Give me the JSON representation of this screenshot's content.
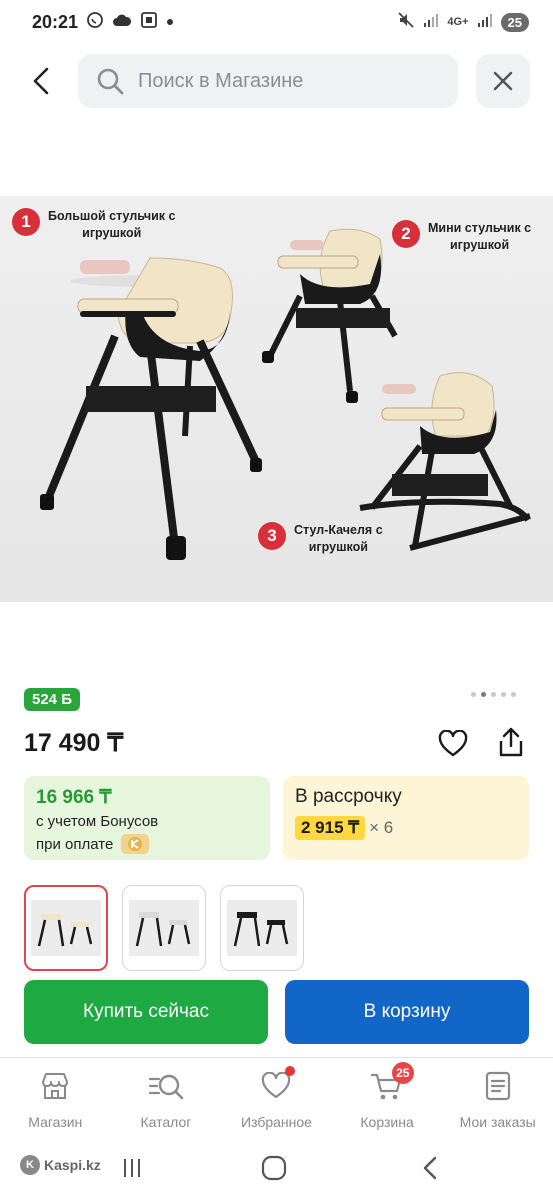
{
  "status_bar": {
    "time": "20:21",
    "network": "4G+",
    "battery": "25"
  },
  "search": {
    "placeholder": "Поиск в Магазине",
    "back_icon": "chevron-left-icon",
    "search_icon": "search-icon",
    "clear_icon": "close-icon"
  },
  "product_image": {
    "callouts": [
      {
        "number": "1",
        "text_line1": "Большой стульчик с",
        "text_line2": "игрушкой"
      },
      {
        "number": "2",
        "text_line1": "Мини стульчик с",
        "text_line2": "игрушкой"
      },
      {
        "number": "3",
        "text_line1": "Стул-Качеля с",
        "text_line2": "игрушкой"
      }
    ],
    "gallery_count": 5,
    "gallery_active": 2
  },
  "product": {
    "bonus_badge": "524 Б",
    "price": "17 490 ₸",
    "favorite_icon": "heart-icon",
    "share_icon": "share-icon"
  },
  "bonus_offer": {
    "price": "16 966 ₸",
    "line1": "с учетом Бонусов",
    "line2": "при оплате"
  },
  "installment": {
    "title": "В рассрочку",
    "amount": "2 915 ₸",
    "times": "× 6"
  },
  "thumbnails": {
    "count": 3,
    "active_index": 0
  },
  "actions": {
    "buy_now": "Купить сейчас",
    "add_to_cart": "В корзину"
  },
  "bottom_nav": {
    "items": [
      {
        "label": "Магазин",
        "icon": "store-icon"
      },
      {
        "label": "Каталог",
        "icon": "catalog-search-icon"
      },
      {
        "label": "Избранное",
        "icon": "heart-icon"
      },
      {
        "label": "Корзина",
        "icon": "cart-icon",
        "badge": "25"
      },
      {
        "label": "Мои заказы",
        "icon": "orders-icon"
      }
    ]
  },
  "watermark": "Kaspi.kz",
  "colors": {
    "buy_green": "#1fa943",
    "cart_blue": "#1166c8",
    "bonus_green": "#2aa53c",
    "callout_red": "#d8303a",
    "installment_yellow": "#ffd740"
  }
}
